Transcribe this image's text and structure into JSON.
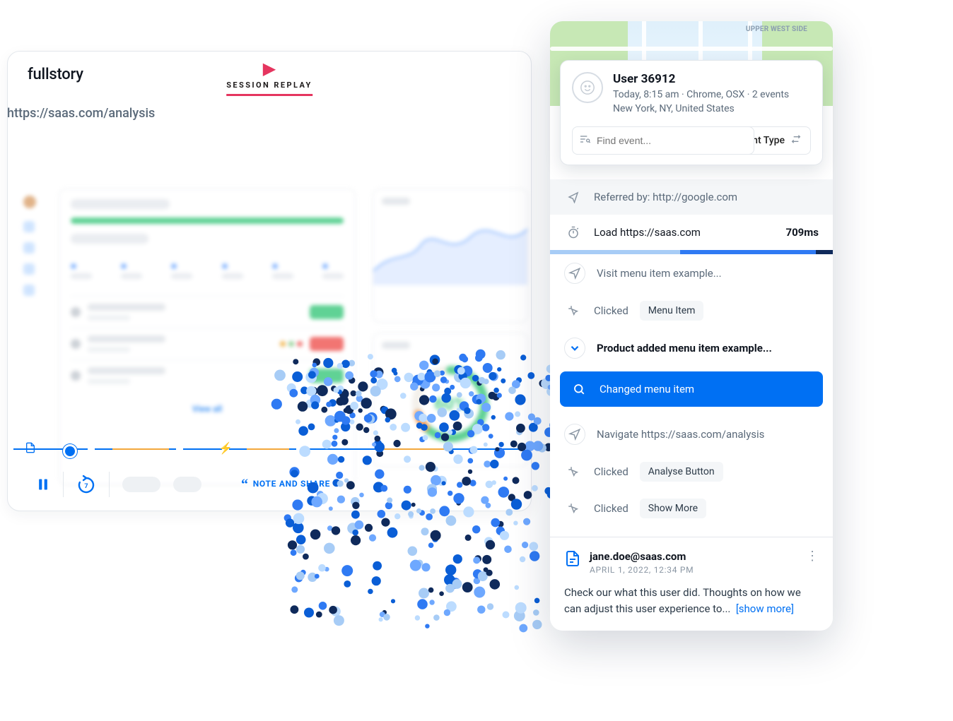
{
  "brand": {
    "logo_text": "fullstory"
  },
  "badge": {
    "label": "SESSION REPLAY"
  },
  "replay": {
    "url": "https://saas.com/analysis",
    "ring_pct": "60%",
    "link_text": "View all"
  },
  "controls": {
    "note_share": "NOTE AND SHARE",
    "rewind_number": "7"
  },
  "map": {
    "label_upper_west": "UPPER WEST SIDE"
  },
  "user": {
    "name": "User 36912",
    "meta_line1": "Today, 8:15 am · Chrome, OSX · 2 events",
    "meta_line2": "New York, NY, United States"
  },
  "search": {
    "placeholder": "Find event...",
    "event_type_label": "Event Type"
  },
  "events": {
    "referred": "Referred by: http://google.com",
    "load_text": "Load https://saas.com",
    "load_time": "709ms",
    "visit": "Visit menu item example...",
    "clicked_label": "Clicked",
    "clicked_chip_1": "Menu Item",
    "expanded": "Product added menu item example...",
    "active": "Changed menu item",
    "navigate": "Navigate https://saas.com/analysis",
    "clicked_chip_2": "Analyse Button",
    "clicked_chip_3": "Show More"
  },
  "note": {
    "author": "jane.doe@saas.com",
    "date": "APRIL 1, 2022, 12:34 PM",
    "body": "Check our what this user did. Thoughts on how we can adjust this user experience to...",
    "show_more": "[show more]"
  }
}
